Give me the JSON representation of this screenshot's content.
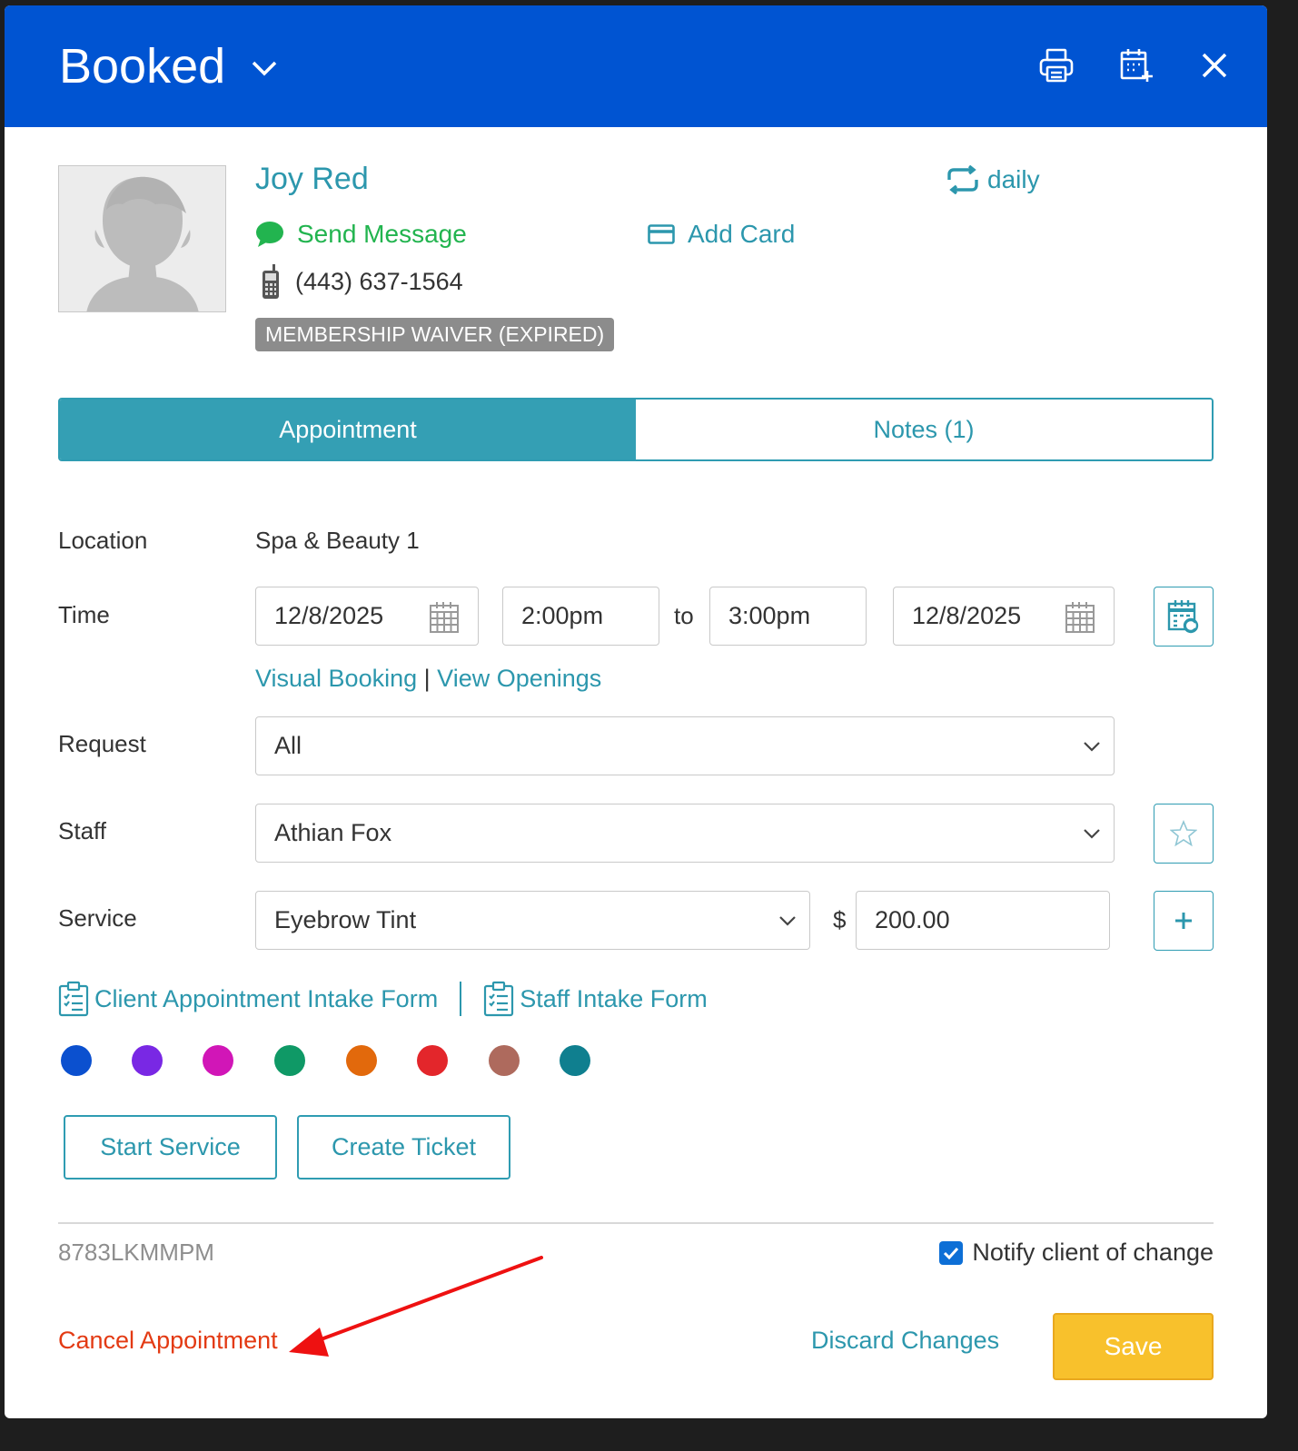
{
  "header": {
    "status": "Booked",
    "icons": [
      "printer-icon",
      "calendar-add-icon",
      "close-icon"
    ]
  },
  "client": {
    "name": "Joy Red",
    "recurrence": "daily",
    "send_message": "Send Message",
    "add_card": "Add Card",
    "phone": "(443) 637-1564",
    "badge": "MEMBERSHIP WAIVER (EXPIRED)"
  },
  "tabs": {
    "appointment": "Appointment",
    "notes": "Notes (1)"
  },
  "form": {
    "location_label": "Location",
    "location_value": "Spa & Beauty 1",
    "time_label": "Time",
    "start_date": "12/8/2025",
    "start_time": "2:00pm",
    "to_label": "to",
    "end_time": "3:00pm",
    "end_date": "12/8/2025",
    "visual_booking": "Visual Booking",
    "links_separator": "|",
    "view_openings": "View Openings",
    "request_label": "Request",
    "request_value": "All",
    "staff_label": "Staff",
    "staff_value": "Athian Fox",
    "service_label": "Service",
    "service_value": "Eyebrow Tint",
    "currency": "$",
    "price": "200.00"
  },
  "intake": {
    "client_form": "Client Appointment Intake Form",
    "staff_form": "Staff Intake Form"
  },
  "colors": {
    "swatches": [
      "#0b50cf",
      "#7928e4",
      "#d116b7",
      "#0f9966",
      "#e2690c",
      "#e3262b",
      "#ae6a5d",
      "#0f7f8f"
    ],
    "header": "#0054d2",
    "accent": "#2c97ad",
    "danger": "#e33a13",
    "save": "#f8c12c"
  },
  "actions": {
    "start_service": "Start Service",
    "create_ticket": "Create Ticket",
    "cancel": "Cancel Appointment",
    "discard": "Discard Changes",
    "save": "Save"
  },
  "footer": {
    "booking_code": "8783LKMMPM",
    "notify_label": "Notify client of change",
    "notify_checked": true
  }
}
